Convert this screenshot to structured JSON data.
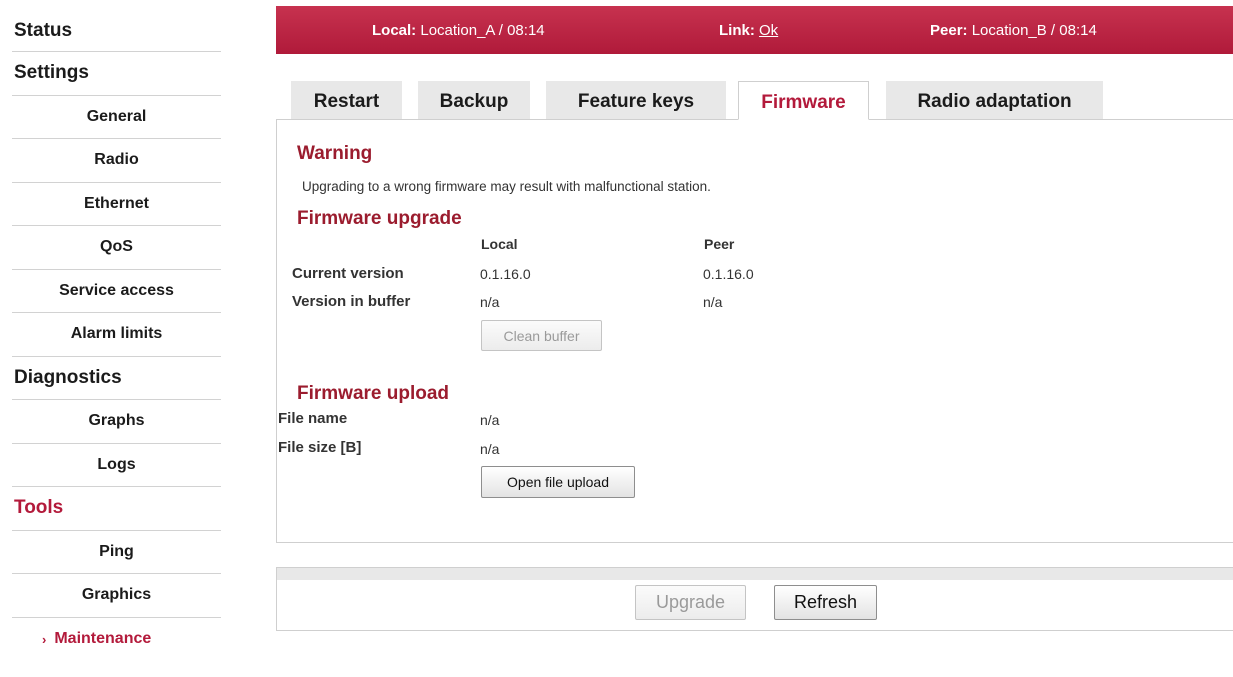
{
  "sidebar": {
    "items": [
      {
        "label": "Status"
      },
      {
        "label": "Settings"
      },
      {
        "label": "General"
      },
      {
        "label": "Radio"
      },
      {
        "label": "Ethernet"
      },
      {
        "label": "QoS"
      },
      {
        "label": "Service access"
      },
      {
        "label": "Alarm limits"
      },
      {
        "label": "Diagnostics"
      },
      {
        "label": "Graphs"
      },
      {
        "label": "Logs"
      },
      {
        "label": "Tools"
      },
      {
        "label": "Ping"
      },
      {
        "label": "Graphics"
      },
      {
        "label": "Maintenance",
        "marker": "›"
      }
    ]
  },
  "header": {
    "local_label": "Local:",
    "local_value": "Location_A / 08:14",
    "link_label": "Link:",
    "link_value": "Ok",
    "peer_label": "Peer:",
    "peer_value": "Location_B / 08:14"
  },
  "tabs": [
    {
      "label": "Restart"
    },
    {
      "label": "Backup"
    },
    {
      "label": "Feature keys"
    },
    {
      "label": "Firmware"
    },
    {
      "label": "Radio adaptation"
    }
  ],
  "warning": {
    "title": "Warning",
    "text": "Upgrading to a wrong firmware may result with malfunctional station."
  },
  "firmware_upgrade": {
    "title": "Firmware upgrade",
    "col_local": "Local",
    "col_peer": "Peer",
    "rows": [
      {
        "label": "Current version",
        "local": "0.1.16.0",
        "peer": "0.1.16.0"
      },
      {
        "label": "Version in buffer",
        "local": "n/a",
        "peer": "n/a"
      }
    ],
    "clean_button": "Clean buffer"
  },
  "firmware_upload": {
    "title": "Firmware upload",
    "rows": [
      {
        "label": "File name",
        "value": "n/a"
      },
      {
        "label": "File size [B]",
        "value": "n/a"
      }
    ],
    "open_button": "Open file upload"
  },
  "actions": {
    "upgrade": "Upgrade",
    "refresh": "Refresh"
  },
  "colors": {
    "accent": "#b31a3b",
    "header_bar": "#b01a3a",
    "heading": "#9b1c2e"
  }
}
